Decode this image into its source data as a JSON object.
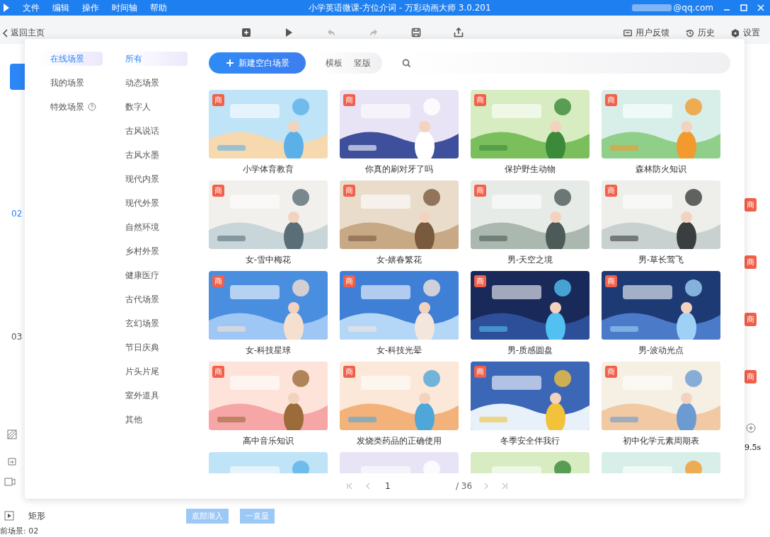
{
  "window": {
    "title": "小学英语微课-方位介词 - 万彩动画大师 3.0.201",
    "menu": [
      "文件",
      "编辑",
      "操作",
      "时间轴",
      "帮助"
    ],
    "account": "@qq.com"
  },
  "toolbar": {
    "back": "返回主页",
    "tools": [
      {
        "kind": "new"
      },
      {
        "kind": "play"
      },
      {
        "kind": "undo"
      },
      {
        "kind": "redo"
      },
      {
        "kind": "save"
      },
      {
        "kind": "publish"
      }
    ],
    "right": [
      {
        "kind": "feedback",
        "label": "用户反馈"
      },
      {
        "kind": "history",
        "label": "历史"
      },
      {
        "kind": "settings",
        "label": "设置"
      }
    ]
  },
  "editor": {
    "scenes": [
      "02",
      "03"
    ],
    "right_badges": [
      "商",
      "商",
      "商",
      "商"
    ],
    "duration": "9.5s",
    "layer": {
      "name": "矩形",
      "enter": "底部渐入",
      "stay": "一直显"
    },
    "status": "前场景: 02"
  },
  "dialog": {
    "sources": [
      {
        "label": "在线场景",
        "selected": true,
        "help": false
      },
      {
        "label": "我的场景",
        "selected": false,
        "help": false
      },
      {
        "label": "特效场景",
        "selected": false,
        "help": true
      }
    ],
    "categories": [
      {
        "label": "所有",
        "selected": true
      },
      {
        "label": "动态场景",
        "selected": false
      },
      {
        "label": "数字人",
        "selected": false
      },
      {
        "label": "古风说话",
        "selected": false
      },
      {
        "label": "古风水墨",
        "selected": false
      },
      {
        "label": "现代内景",
        "selected": false
      },
      {
        "label": "现代外景",
        "selected": false
      },
      {
        "label": "自然环境",
        "selected": false
      },
      {
        "label": "乡村外景",
        "selected": false
      },
      {
        "label": "健康医疗",
        "selected": false
      },
      {
        "label": "古代场景",
        "selected": false
      },
      {
        "label": "玄幻场景",
        "selected": false
      },
      {
        "label": "节日庆典",
        "selected": false
      },
      {
        "label": "片头片尾",
        "selected": false
      },
      {
        "label": "室外道具",
        "selected": false
      },
      {
        "label": "其他",
        "selected": false
      }
    ],
    "new_button": "新建空白场景",
    "orientation": [
      {
        "label": "横板",
        "selected": false
      },
      {
        "label": "竖版",
        "selected": false
      }
    ],
    "cards": [
      {
        "kind": "template",
        "title": "小学体育教育",
        "badge": "商"
      },
      {
        "kind": "template",
        "title": "你真的刷对牙了吗",
        "badge": "商"
      },
      {
        "kind": "template",
        "title": "保护野生动物",
        "badge": "商"
      },
      {
        "kind": "template",
        "title": "森林防火知识",
        "badge": "商"
      },
      {
        "kind": "template",
        "title": "女-雪中梅花",
        "badge": "商"
      },
      {
        "kind": "template",
        "title": "女-嬉春繁花",
        "badge": "商"
      },
      {
        "kind": "template",
        "title": "男-天空之境",
        "badge": "商"
      },
      {
        "kind": "template",
        "title": "男-草长莺飞",
        "badge": "商"
      },
      {
        "kind": "template",
        "title": "女-科技星球",
        "badge": "商"
      },
      {
        "kind": "template",
        "title": "女-科技光晕",
        "badge": "商"
      },
      {
        "kind": "template",
        "title": "男-质感圆盘",
        "badge": "商"
      },
      {
        "kind": "template",
        "title": "男-波动光点",
        "badge": "商"
      },
      {
        "kind": "template",
        "title": "高中音乐知识",
        "badge": "商"
      },
      {
        "kind": "template",
        "title": "发烧类药品的正确使用",
        "badge": "商"
      },
      {
        "kind": "template",
        "title": "冬季安全伴我行",
        "badge": "商"
      },
      {
        "kind": "template",
        "title": "初中化学元素周期表",
        "badge": "商"
      },
      {
        "kind": "picture"
      },
      {
        "kind": "picture"
      },
      {
        "kind": "picture"
      },
      {
        "kind": "picture"
      }
    ],
    "pagination": {
      "page": "1",
      "total": "/ 36"
    }
  }
}
